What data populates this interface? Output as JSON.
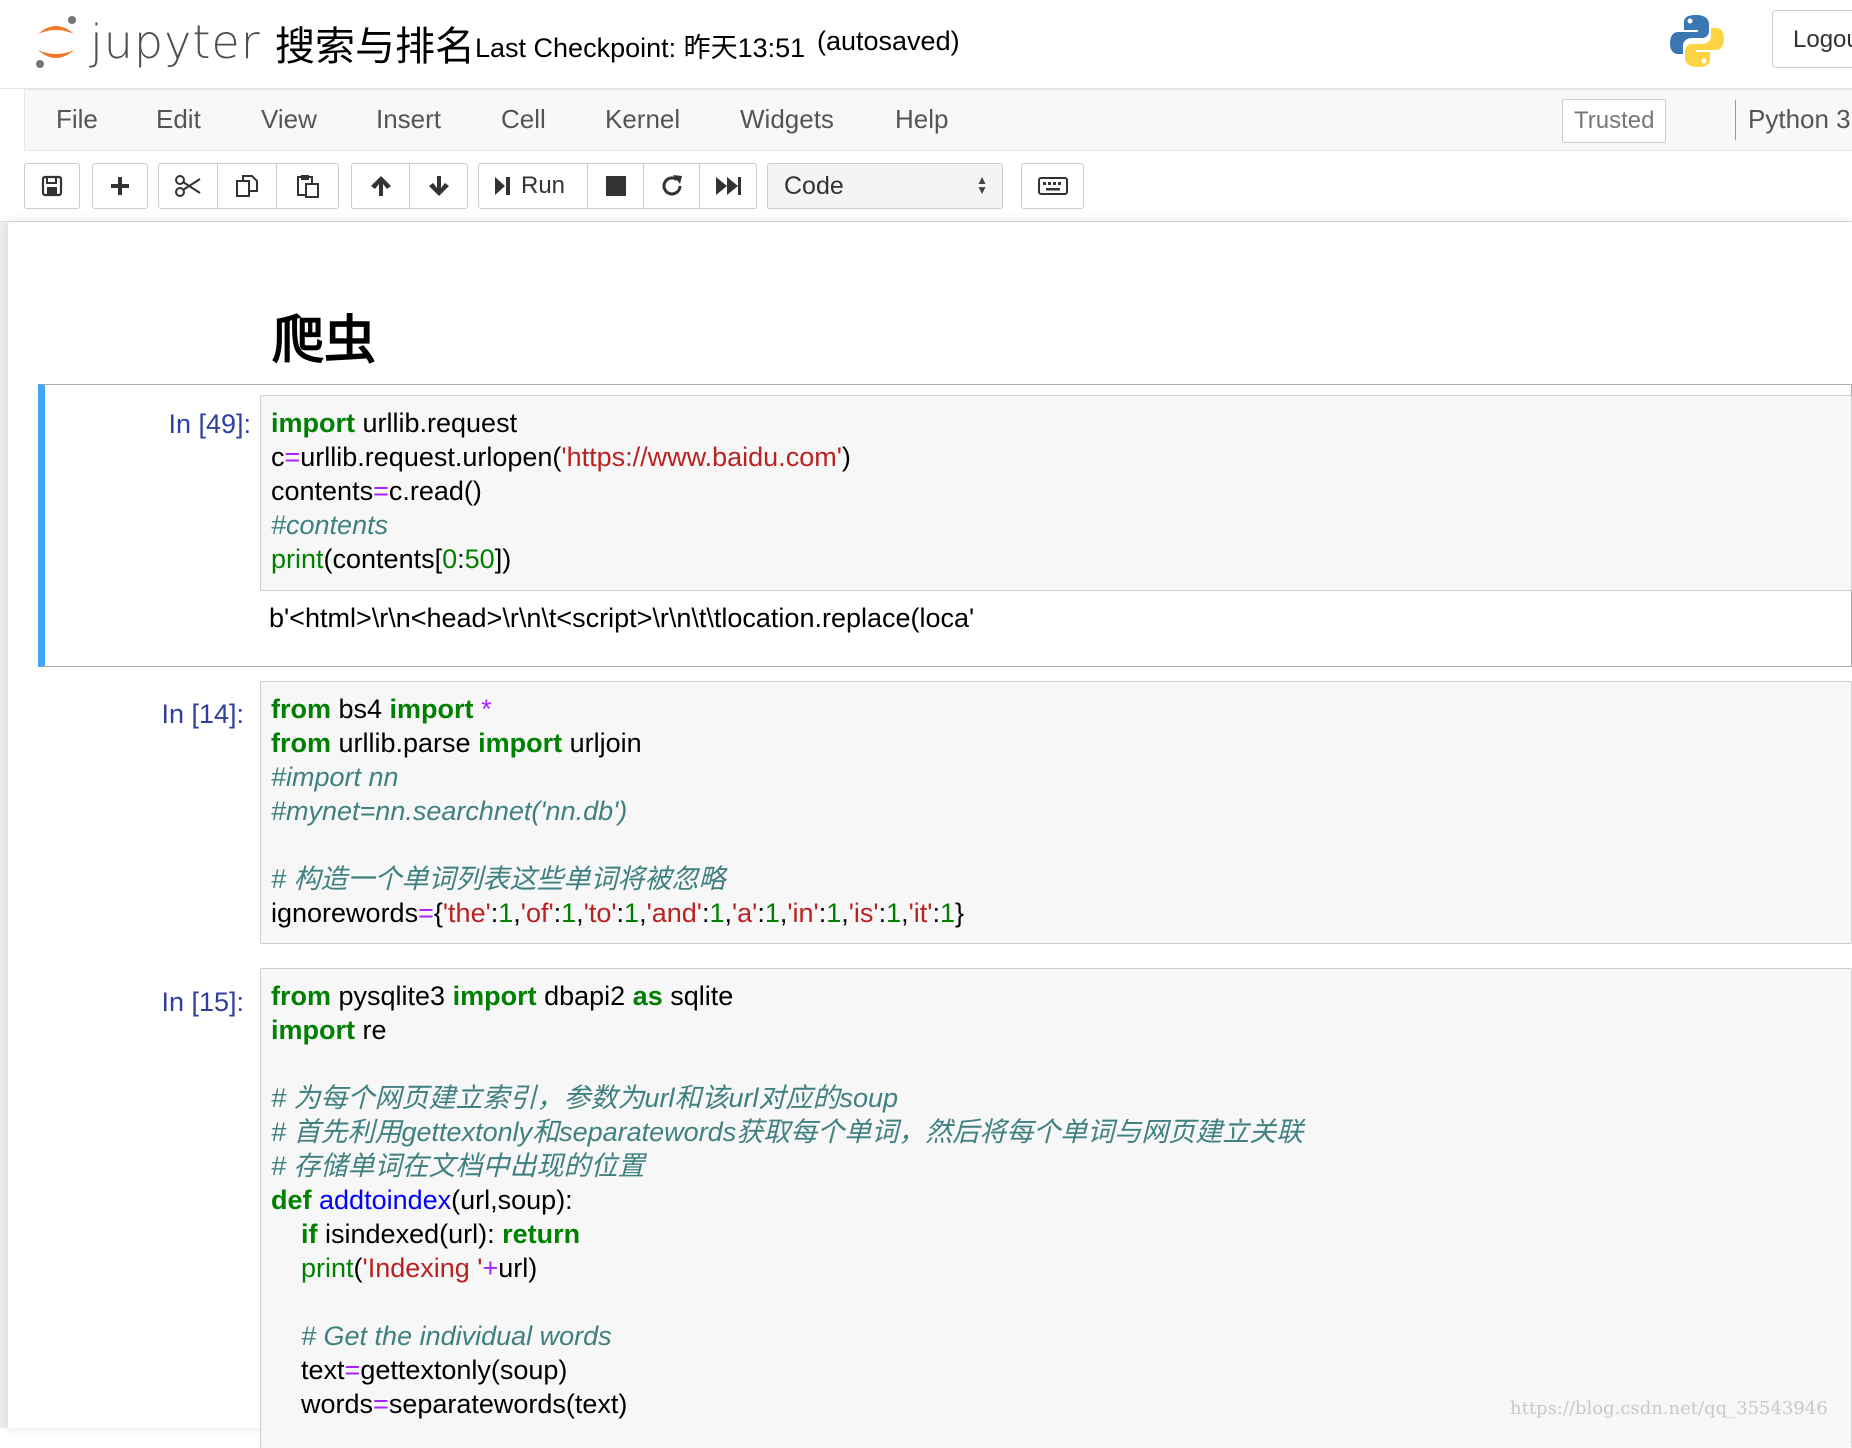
{
  "header": {
    "logo_text": "jupyter",
    "notebook_title": "搜索与排名",
    "checkpoint": "Last Checkpoint: 昨天13:51",
    "autosave_status": "(autosaved)",
    "logout_label": "Logout"
  },
  "menubar": {
    "items": [
      "File",
      "Edit",
      "View",
      "Insert",
      "Cell",
      "Kernel",
      "Widgets",
      "Help"
    ],
    "trusted_label": "Trusted",
    "kernel_name": "Python 3"
  },
  "toolbar": {
    "run_label": "Run",
    "cell_type": "Code",
    "icons": [
      "save-icon",
      "plus-icon",
      "scissors-icon",
      "copy-icon",
      "paste-icon",
      "arrow-up-icon",
      "arrow-down-icon",
      "step-forward-icon",
      "stop-icon",
      "restart-icon",
      "fast-forward-icon",
      "keyboard-icon"
    ]
  },
  "notebook": {
    "heading": "爬虫",
    "cells": [
      {
        "prompt": "In [49]:",
        "code_lines": [
          "import urllib.request",
          "c=urllib.request.urlopen('https://www.baidu.com')",
          "contents=c.read()",
          "#contents",
          "print(contents[0:50])"
        ],
        "output": "b'<html>\\r\\n<head>\\r\\n\\t<script>\\r\\n\\t\\tlocation.replace(loca'"
      },
      {
        "prompt": "In [14]:",
        "code_lines": [
          "from bs4 import *",
          "from urllib.parse import urljoin",
          "#import nn",
          "#mynet=nn.searchnet('nn.db')",
          "",
          "# 构造一个单词列表这些单词将被忽略",
          "ignorewords={'the':1,'of':1,'to':1,'and':1,'a':1,'in':1,'is':1,'it':1}"
        ]
      },
      {
        "prompt": "In [15]:",
        "code_lines": [
          "from pysqlite3 import dbapi2 as sqlite",
          "import re",
          "",
          "# 为每个网页建立索引，参数为url和该url对应的soup",
          "# 首先利用gettextonly和separatewords获取每个单词，然后将每个单词与网页建立关联",
          "# 存储单词在文档中出现的位置",
          "def addtoindex(url,soup):",
          "    if isindexed(url): return",
          "    print('Indexing '+url)",
          "",
          "    # Get the individual words",
          "    text=gettextonly(soup)",
          "    words=separatewords(text)"
        ]
      }
    ]
  },
  "watermark": "https://blog.csdn.net/qq_35543946",
  "colors": {
    "keyword": "#008000",
    "string": "#ba2121",
    "comment": "#408080",
    "operator": "#aa22ff",
    "function_name": "#0000ff",
    "prompt": "#303f9f",
    "selected_cell_bar": "#42a5f5",
    "logo_orange": "#f37726"
  }
}
